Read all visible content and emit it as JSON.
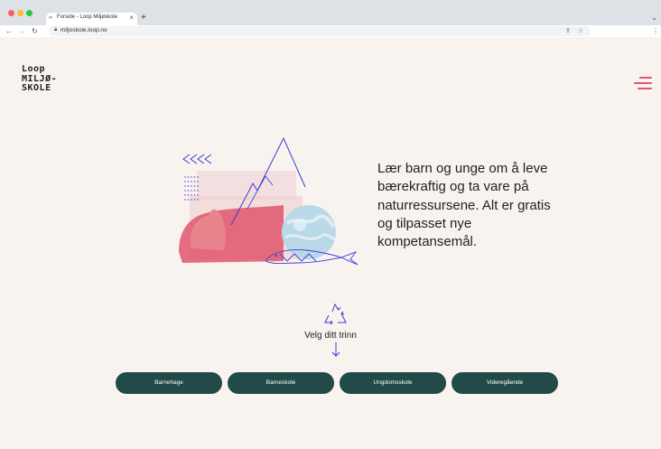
{
  "browser": {
    "tab": {
      "title": "Forside - Loop Miljøskole"
    },
    "address": {
      "url": "miljoskole.loop.no"
    }
  },
  "header": {
    "logo_lines": [
      "Loop",
      "MILJØ-",
      "SKOLE"
    ]
  },
  "hero": {
    "text": "Lær barn og unge om å leve bærekraftig og ta vare på naturressursene. Alt er gratis og tilpasset nye kompetansemål."
  },
  "level_select": {
    "prompt": "Velg ditt trinn",
    "buttons": [
      "Barnehage",
      "Barneskole",
      "Ungdomsskole",
      "Videregående"
    ]
  },
  "colors": {
    "accent": "#e0566b",
    "button_bg": "#214a48",
    "page_bg": "#f8f3ef",
    "line_art": "#3d3bd6"
  }
}
